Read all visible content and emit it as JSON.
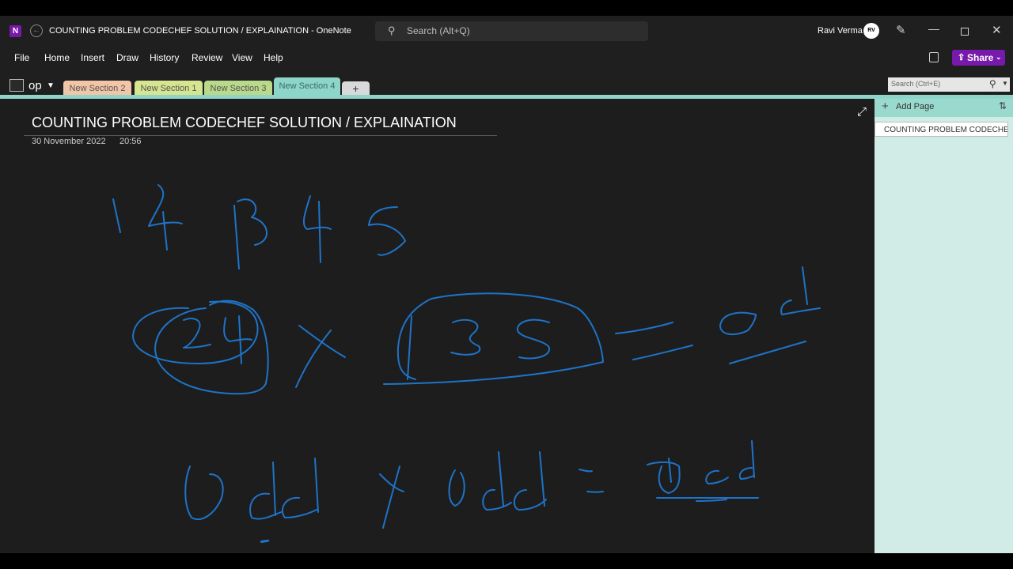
{
  "window": {
    "app_icon": "onenote-icon",
    "title": "COUNTING PROBLEM CODECHEF SOLUTION / EXPLAINATION  -  OneNote",
    "search_placeholder": "Search (Alt+Q)",
    "user_name": "Ravi Verma"
  },
  "menu": {
    "items": [
      "File",
      "Home",
      "Insert",
      "Draw",
      "History",
      "Review",
      "View",
      "Help"
    ],
    "share_label": "Share"
  },
  "notebook": {
    "name": "op",
    "tabs": [
      {
        "label": "New Section 2",
        "color": "#f2c5a8"
      },
      {
        "label": "New Section 1",
        "color": "#d6e590"
      },
      {
        "label": "New Section 3",
        "color": "#b9d98b"
      },
      {
        "label": "New Section 4",
        "color": "#8ed5c9",
        "active": true
      }
    ],
    "add_tab_label": "+",
    "search_placeholder": "Search (Ctrl+E)"
  },
  "page": {
    "title": "COUNTING PROBLEM CODECHEF SOLUTION / EXPLAINATION",
    "date": "30 November 2022",
    "time": "20:56",
    "ink_color": "#1e73c8"
  },
  "pages_pane": {
    "add_page_label": "Add Page",
    "pages": [
      "COUNTING PROBLEM CODECHEF"
    ]
  }
}
